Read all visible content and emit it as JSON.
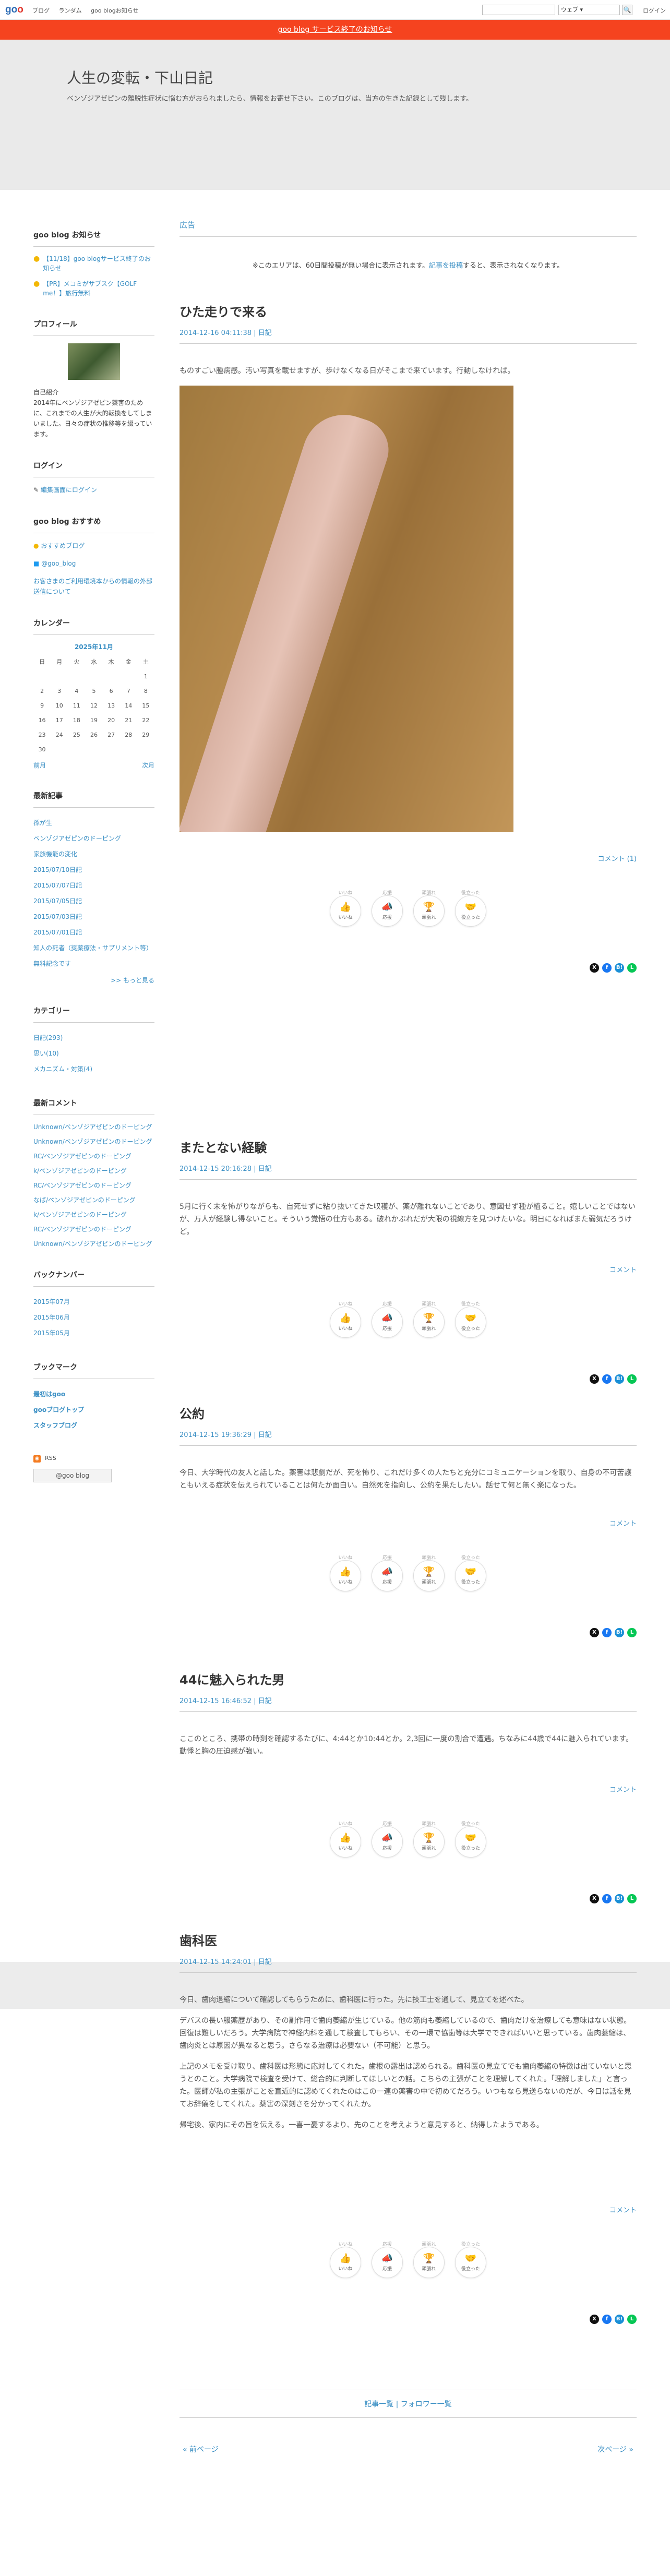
{
  "topbar": {
    "links": [
      "ブログ",
      "ランダム",
      "goo blogお知らせ"
    ],
    "search_placeholder": "",
    "search_scope": "ウェブ",
    "search_button": "🔍",
    "login": "ログイン"
  },
  "notice": "goo blog サービス終了のお知らせ",
  "header": {
    "title": "人生の変転・下山日記",
    "description": "ベンゾジアゼピンの離脱性症状に悩む方がおられましたら、情報をお寄せ下さい。このブログは、当方の生きた記録として残します。"
  },
  "sidebar": {
    "notices_title": "goo blog お知らせ",
    "notices": [
      "【11/18】goo blogサービス終了のお知らせ",
      "【PR】メコミがサブスク【GOLF me！】旅行無料"
    ],
    "profile_title": "プロフィール",
    "profile_label": "自己紹介",
    "profile_text": "2014年にベンゾジアゼピン薬害のために、これまでの人生が大的転換をしてしまいました。日々の症状の推移等を綴っています。",
    "login_title": "ログイン",
    "login_link": "編集画面にログイン",
    "recommend_title": "goo blog おすすめ",
    "recommend_items": [
      "おすすめブログ",
      "@goo_blog",
      "お客さまのご利用環境本からの情報の外部送信について"
    ],
    "calendar_title": "カレンダー",
    "calendar_month": "2025年11月",
    "calendar_weekdays": [
      "日",
      "月",
      "火",
      "水",
      "木",
      "金",
      "土"
    ],
    "calendar_rows": [
      [
        "",
        "",
        "",
        "",
        "",
        "",
        "1"
      ],
      [
        "2",
        "3",
        "4",
        "5",
        "6",
        "7",
        "8"
      ],
      [
        "9",
        "10",
        "11",
        "12",
        "13",
        "14",
        "15"
      ],
      [
        "16",
        "17",
        "18",
        "19",
        "20",
        "21",
        "22"
      ],
      [
        "23",
        "24",
        "25",
        "26",
        "27",
        "28",
        "29"
      ],
      [
        "30",
        "",
        "",
        "",
        "",
        "",
        ""
      ]
    ],
    "calendar_prev": "前月",
    "calendar_next": "次月",
    "recent_title": "最新記事",
    "recent_posts": [
      "孫が生",
      "ベンゾジアゼピンのドーピング",
      "家族機能の変化",
      "2015/07/10日記",
      "2015/07/07日記",
      "2015/07/05日記",
      "2015/07/03日記",
      "2015/07/01日記",
      "知人の死者（奨薬療法・サプリメント等）",
      "無料記念です"
    ],
    "more": ">> もっと見る",
    "category_title": "カテゴリー",
    "categories": [
      "日記(293)",
      "思い(10)",
      "メカニズム・対策(4)"
    ],
    "comments_title": "最新コメント",
    "comments": [
      "Unknown/ベンゾジアゼピンのドーピング",
      "Unknown/ベンゾジアゼピンのドーピング",
      "RC/ベンゾジアゼピンのドーピング",
      "k/ベンゾジアゼピンのドーピング",
      "RC/ベンゾジアゼピンのドーピング",
      "なば/ベンゾジアゼピンのドーピング",
      "k/ベンゾジアゼピンのドーピング",
      "RC/ベンゾジアゼピンのドーピング",
      "Unknown/ベンゾジアゼピンのドーピング"
    ],
    "backnumber_title": "バックナンバー",
    "backnumbers": [
      "2015年07月",
      "2015年06月",
      "2015年05月"
    ],
    "bookmark_title": "ブックマーク",
    "bookmarks": [
      "最初はgoo",
      "gooブログトップ",
      "スタッフブログ"
    ],
    "rss_label": "RSS",
    "goo_badge": "@goo blog"
  },
  "main": {
    "ad_label": "広告",
    "ad_text_before": "※このエリアは、60日間投稿が無い場合に表示されます。",
    "ad_link": "記事を投稿",
    "ad_text_after": "すると、表示されなくなります。",
    "comment_label": "コメント",
    "reactions": [
      {
        "count": "いいね",
        "emoji": "👍",
        "label": "いいね"
      },
      {
        "count": "応援",
        "emoji": "📣",
        "label": "応援"
      },
      {
        "count": "頑張れ",
        "emoji": "🏆",
        "label": "頑張れ"
      },
      {
        "count": "役立った",
        "emoji": "🤝",
        "label": "役立った"
      }
    ],
    "share_icons": [
      "X",
      "f",
      "B!",
      "L"
    ],
    "posts": [
      {
        "title": "ひた走りで来る",
        "date": "2014-12-16 04:11:38",
        "category": "日記",
        "body": [
          "ものすごい腫病感。汚い写真を載せますが、歩けなくなる日がそこまで来ています。行動しなければ。"
        ],
        "comment": "コメント (1)"
      },
      {
        "title": "またとない経験",
        "date": "2014-12-15 20:16:28",
        "category": "日記",
        "body": [
          "5月に行く末を怖がりながらも、自死せずに粘り抜いてきた収穫が、薬が離れないことであり、意図せず種が植ること。嬉しいことではないが、万人が経験し得ないこと。そういう覚悟の仕方もある。破れかぶれだが大限の視線方を見つけたいな。明日になればまた弱気だろうけど。"
        ],
        "comment": "コメント"
      },
      {
        "title": "公約",
        "date": "2014-12-15 19:36:29",
        "category": "日記",
        "body": [
          "今日、大学時代の友人と話した。薬害は悲劇だが、死を怖り、これだけ多くの人たちと充分にコミュニケーションを取り、自身の不可苦護ともいえる症状を伝えられていることは何たか面白い。自然死を指向し、公約を果たしたい。話せて何と無く楽になった。"
        ],
        "comment": "コメント"
      },
      {
        "title": "44に魅入られた男",
        "date": "2014-12-15 16:46:52",
        "category": "日記",
        "body": [
          "ここのところ、携帯の時刻を確認するたびに、4:44とか10:44とか。2,3回に一度の割合で遭遇。ちなみに44歳で44に魅入られています。動悸と胸の圧迫感が強い。"
        ],
        "comment": "コメント"
      },
      {
        "title": "歯科医",
        "date": "2014-12-15 14:24:01",
        "category": "日記",
        "body": [
          "今日、歯肉退縮について確認してもらうために、歯科医に行った。先に技工士を通して、見立てを述べた。",
          "デバスの長い服薬歴があり、その副作用で歯肉萎縮が生じている。他の筋肉も萎縮しているので、歯肉だけを治療しても意味はない状態。回復は難しいだろう。大学病院で神経内科を通して検査してもらい、その一環で協歯等は大学でできればいいと思っている。歯肉萎縮は、歯肉炎とは原因が異なると思う。さらなる治療は必要ない（不可能）と思う。",
          "上記のメモを受け取り、歯科医は形態に応対してくれた。歯根の露出は認められる。歯科医の見立てでも歯肉萎縮の特徴は出ていないと思うとのこと。大学病院で検査を受けて、総合的に判断してほしいとの話。こちらの主張がことを理解してくれた。「理解しました」と言った。医師が私の主張がことを直近的に認めてくれたのはこの一連の薬害の中で初めてだろう。いつもなら見送らないのだが、今日は話を見てお辞儀をしてくれた。薬害の深刻さを分かってくれたか。",
          "帰宅後、家内にその旨を伝える。一喜一憂するより、先のことを考えようと意見すると、納得したようである。"
        ],
        "comment": "コメント"
      }
    ],
    "nav_center": "記事一覧 | フォロワー一覧",
    "nav_prev": "« 前ページ",
    "nav_next": "次ページ »"
  },
  "colors": {
    "accent": "#3a8fc4",
    "notice_bar": "#f5431f",
    "header_bg": "#eaeaea"
  }
}
